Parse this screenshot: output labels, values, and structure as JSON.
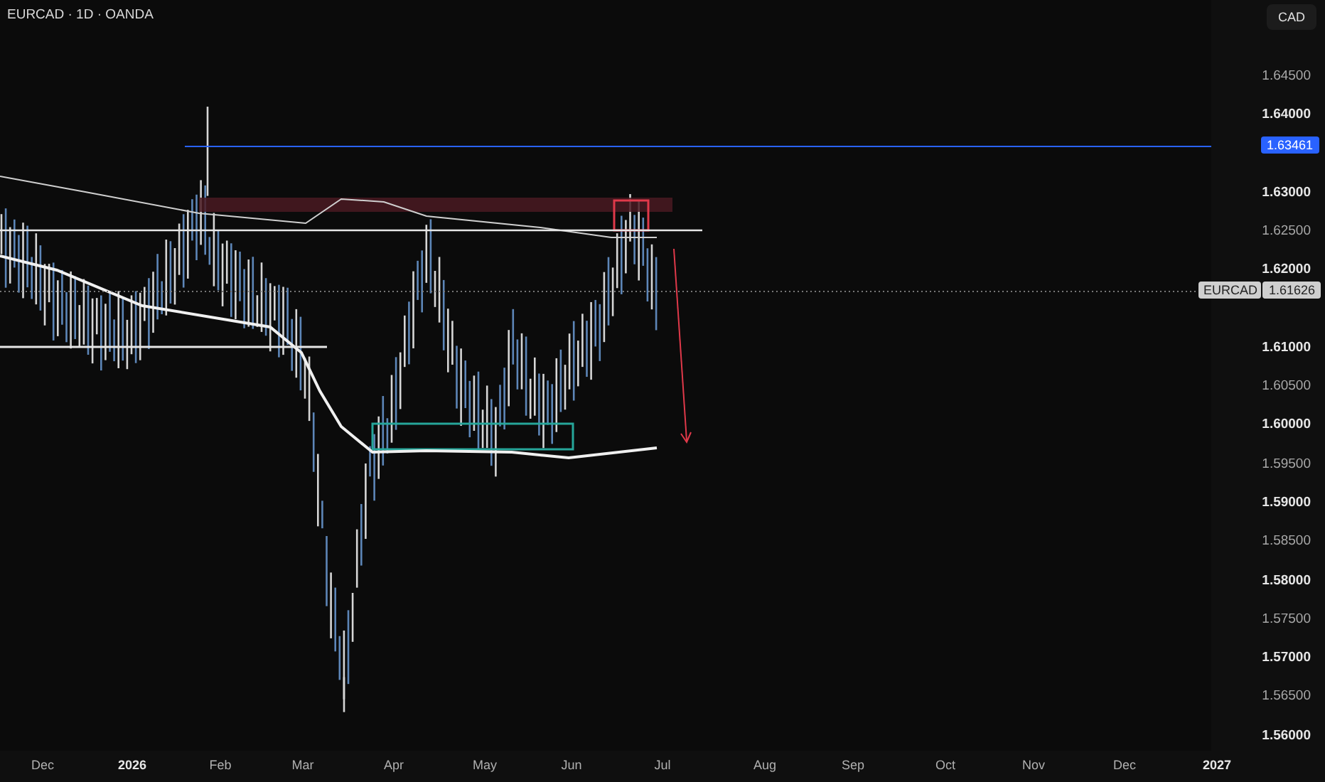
{
  "header": {
    "title": "EURCAD · 1D · OANDA",
    "currency_button": "CAD"
  },
  "price_axis": [
    {
      "text": "1.64500",
      "major": false
    },
    {
      "text": "1.64000",
      "major": true
    },
    {
      "text": "1.63000",
      "major": true
    },
    {
      "text": "1.62500",
      "major": false
    },
    {
      "text": "1.62000",
      "major": true
    },
    {
      "text": "1.61000",
      "major": true
    },
    {
      "text": "1.60500",
      "major": false
    },
    {
      "text": "1.60000",
      "major": true
    },
    {
      "text": "1.59500",
      "major": false
    },
    {
      "text": "1.59000",
      "major": true
    },
    {
      "text": "1.58500",
      "major": false
    },
    {
      "text": "1.58000",
      "major": true
    },
    {
      "text": "1.57500",
      "major": false
    },
    {
      "text": "1.57000",
      "major": true
    },
    {
      "text": "1.56500",
      "major": false
    },
    {
      "text": "1.56000",
      "major": true
    }
  ],
  "markers": [
    {
      "kind": "line_price",
      "text": "1.63461"
    },
    {
      "kind": "symbol",
      "symbol": "EURCAD",
      "text": "1.61626"
    }
  ],
  "time_axis": [
    {
      "text": "Dec",
      "major": false
    },
    {
      "text": "2026",
      "major": true
    },
    {
      "text": "Feb",
      "major": false
    },
    {
      "text": "Mar",
      "major": false
    },
    {
      "text": "Apr",
      "major": false
    },
    {
      "text": "May",
      "major": false
    },
    {
      "text": "Jun",
      "major": false
    },
    {
      "text": "Jul",
      "major": false
    },
    {
      "text": "Aug",
      "major": false
    },
    {
      "text": "Sep",
      "major": false
    },
    {
      "text": "Oct",
      "major": false
    },
    {
      "text": "Nov",
      "major": false
    },
    {
      "text": "Dec",
      "major": false
    },
    {
      "text": "2027",
      "major": true
    }
  ]
}
